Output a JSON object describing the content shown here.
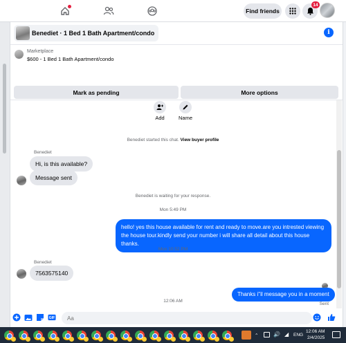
{
  "topbar": {
    "find_friends": "Find friends",
    "notification_count": "14",
    "icons": [
      "home-icon",
      "friends-icon",
      "groups-icon",
      "apps-grid-icon",
      "bell-icon"
    ]
  },
  "chat": {
    "title": "Benediet · 1 Bed 1 Bath Apartment/condo",
    "marketplace_label": "Marketplace",
    "listing": "$600 - 1 Bed 1 Bath Apartment/condo",
    "mark_pending": "Mark as pending",
    "more_options": "More options",
    "quick_actions": [
      {
        "label": "Add",
        "icon": "add-person-icon"
      },
      {
        "label": "Name",
        "icon": "pencil-icon"
      }
    ],
    "started_text": "Benediet started this chat.",
    "view_profile": "View buyer profile",
    "sender_name_1": "Benediet",
    "msg_in_1": "Hi, is this available?",
    "msg_in_2": "Message sent",
    "waiting": "Benediet is waiting for your response.",
    "time_1": "Mon 5:49 PM",
    "msg_out_1a": "hello! yes this house available for rent and ready to move.are you intrested viewing",
    "msg_out_1b": "the house tour.kindly send your number i will share all detail about this house thanks.",
    "time_2": "Mon 10:52 PM",
    "sender_name_2": "Benediet",
    "msg_in_3": "7563575140",
    "time_3": "12:06 AM",
    "msg_out_2": "Thanks i\"il message you in a moment",
    "sent_status": "Sent",
    "input_placeholder": "Aa"
  },
  "taskbar": {
    "language": "ENG",
    "time": "12:06 AM",
    "date": "2/4/2025"
  },
  "colors": {
    "accent": "#0866ff",
    "bubble_in": "#e4e6eb",
    "badge": "#e41e3f",
    "taskbar": "#1f2b3a"
  }
}
